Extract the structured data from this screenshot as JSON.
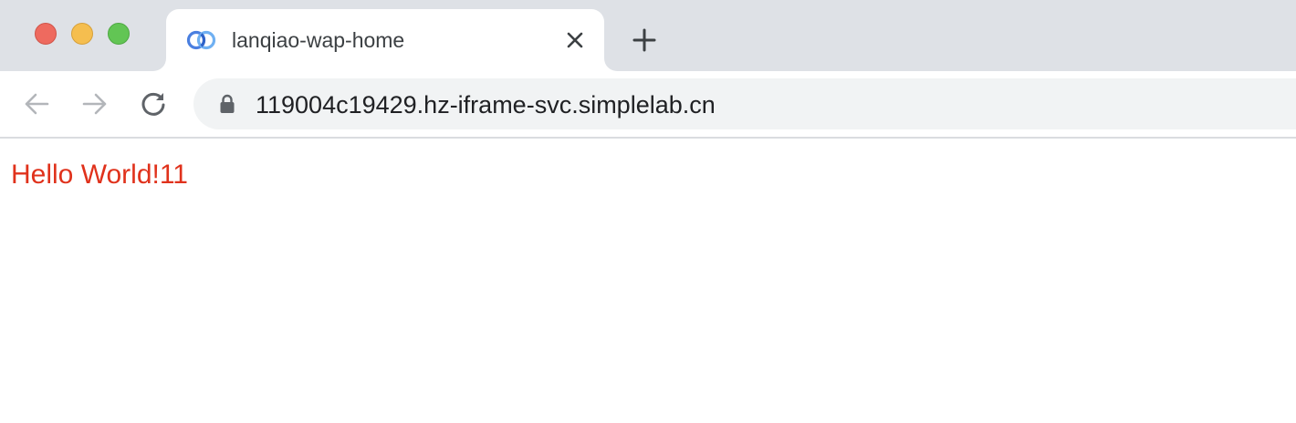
{
  "window": {
    "traffic_lights": {
      "close_color": "#ee6a5f",
      "minimize_color": "#f5be4f",
      "zoom_color": "#62c554"
    }
  },
  "tab": {
    "title": "lanqiao-wap-home",
    "favicon": "lanqiao-logo-icon",
    "close_icon": "close-icon"
  },
  "new_tab": {
    "icon": "plus-icon"
  },
  "toolbar": {
    "back_icon": "arrow-left-icon",
    "forward_icon": "arrow-right-icon",
    "reload_icon": "reload-icon",
    "url": "119004c19429.hz-iframe-svc.simplelab.cn",
    "lock_icon": "lock-icon"
  },
  "page": {
    "heading": "Hello World!11",
    "heading_color": "#e0321c"
  }
}
